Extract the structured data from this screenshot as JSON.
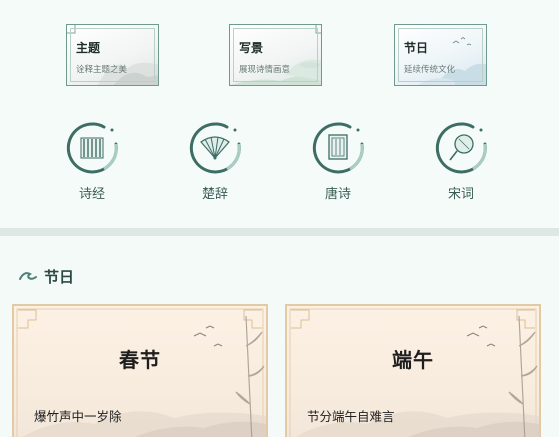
{
  "topic_cards": [
    {
      "title": "主题",
      "subtitle": "诠释主题之美"
    },
    {
      "title": "写景",
      "subtitle": "展现诗情画意"
    },
    {
      "title": "节日",
      "subtitle": "延续传统文化"
    }
  ],
  "categories": [
    {
      "label": "诗经",
      "icon": "bamboo-scroll-icon"
    },
    {
      "label": "楚辞",
      "icon": "folding-fan-icon"
    },
    {
      "label": "唐诗",
      "icon": "book-icon"
    },
    {
      "label": "宋词",
      "icon": "round-fan-icon"
    }
  ],
  "section": {
    "title": "节日",
    "icon": "cloud-swirl-icon"
  },
  "festivals": [
    {
      "name": "春节",
      "line": "爆竹声中一岁除"
    },
    {
      "name": "端午",
      "line": "节分端午自难言"
    }
  ],
  "colors": {
    "accent": "#2f5f55",
    "frame": "#e3c9a4",
    "background": "#f3faf7"
  }
}
